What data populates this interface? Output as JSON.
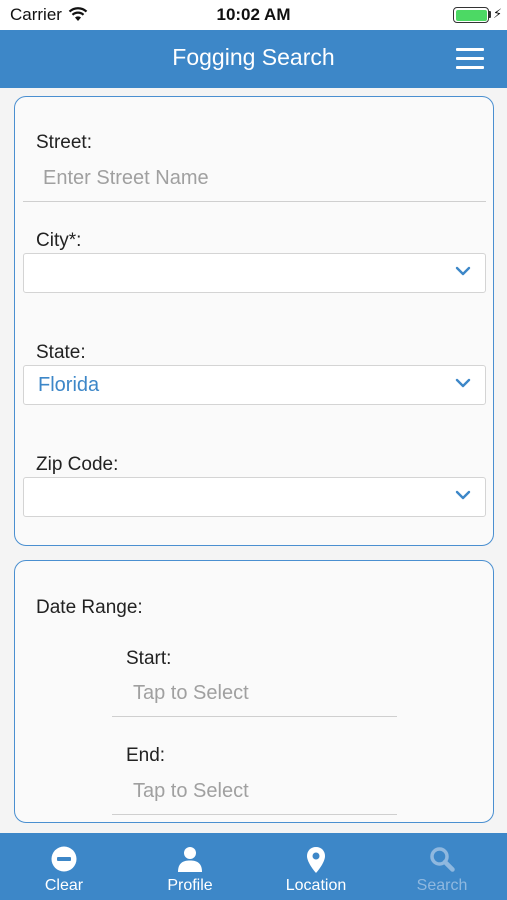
{
  "status_bar": {
    "carrier": "Carrier",
    "time": "10:02 AM"
  },
  "header": {
    "title": "Fogging Search",
    "menu_icon": "hamburger-menu-icon"
  },
  "location_form": {
    "street": {
      "label": "Street:",
      "placeholder": "Enter Street Name",
      "value": ""
    },
    "city": {
      "label": "City*:",
      "value": ""
    },
    "state": {
      "label": "State:",
      "value": "Florida"
    },
    "zip": {
      "label": "Zip Code:",
      "value": ""
    }
  },
  "date_range": {
    "label": "Date Range:",
    "start": {
      "label": "Start:",
      "placeholder": "Tap to Select"
    },
    "end": {
      "label": "End:",
      "placeholder": "Tap to Select"
    }
  },
  "tabs": [
    {
      "label": "Clear",
      "icon": "minus-circle-icon",
      "enabled": true
    },
    {
      "label": "Profile",
      "icon": "person-icon",
      "enabled": true
    },
    {
      "label": "Location",
      "icon": "map-pin-icon",
      "enabled": true
    },
    {
      "label": "Search",
      "icon": "search-icon",
      "enabled": false
    }
  ],
  "colors": {
    "accent": "#3d87c8",
    "card_border": "#4a8fd0",
    "disabled_tab": "#8fb8df",
    "battery": "#4cd964"
  }
}
